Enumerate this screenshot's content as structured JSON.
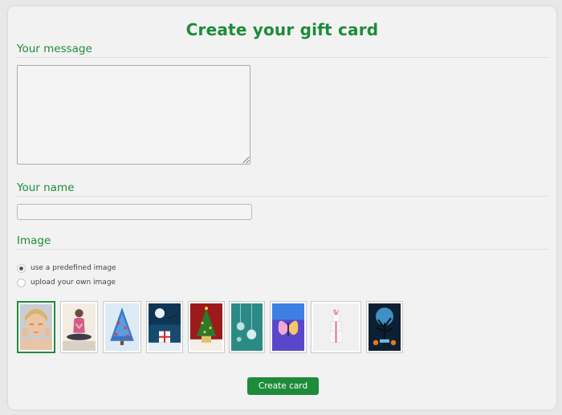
{
  "title": "Create your gift card",
  "message_section": {
    "heading": "Your message",
    "value": ""
  },
  "name_section": {
    "heading": "Your name",
    "value": ""
  },
  "image_section": {
    "heading": "Image",
    "options": [
      {
        "label": "use a predefined image",
        "checked": true
      },
      {
        "label": "upload your own image",
        "checked": false
      }
    ],
    "thumbnails": [
      {
        "icon": "spa-woman-face-image",
        "selected": true
      },
      {
        "icon": "yoga-meditation-image",
        "selected": false
      },
      {
        "icon": "blue-christmas-tree-image",
        "selected": false
      },
      {
        "icon": "santa-night-gift-image",
        "selected": false
      },
      {
        "icon": "red-christmas-tree-image",
        "selected": false
      },
      {
        "icon": "teal-baubles-image",
        "selected": false
      },
      {
        "icon": "purple-butterfly-image",
        "selected": false
      },
      {
        "icon": "gift-boxes-image",
        "selected": false
      },
      {
        "icon": "halloween-tree-image",
        "selected": false
      }
    ]
  },
  "submit_label": "Create card",
  "colors": {
    "accent": "#1e8b3a",
    "panel": "#f2f2f2"
  }
}
